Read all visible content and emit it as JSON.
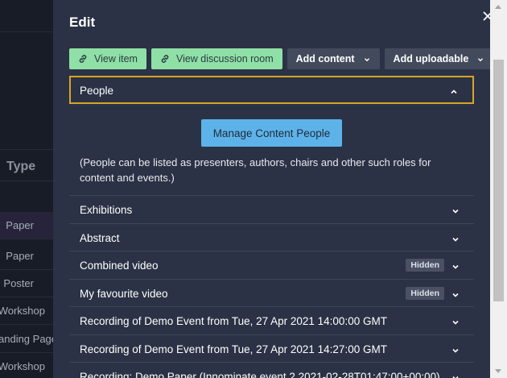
{
  "background": {
    "column_header": "Type",
    "rows": [
      "Paper",
      "Paper",
      "Poster",
      "Workshop",
      "anding Page",
      "Workshop"
    ]
  },
  "drawer": {
    "title": "Edit",
    "toolbar": {
      "view_item": "View item",
      "view_discussion_room": "View discussion room",
      "add_content": "Add content",
      "add_uploadable": "Add uploadable"
    },
    "people": {
      "label": "People",
      "manage_button": "Manage Content People",
      "note": "(People can be listed as presenters, authors, chairs and other such roles for content and events.)"
    },
    "items": [
      {
        "label": "Exhibitions",
        "badge": ""
      },
      {
        "label": "Abstract",
        "badge": ""
      },
      {
        "label": "Combined video",
        "badge": "Hidden"
      },
      {
        "label": "My favourite video",
        "badge": "Hidden"
      },
      {
        "label": "Recording of Demo Event from Tue, 27 Apr 2021 14:00:00 GMT",
        "badge": ""
      },
      {
        "label": "Recording of Demo Event from Tue, 27 Apr 2021 14:27:00 GMT",
        "badge": ""
      },
      {
        "label": "Recording: Demo Paper (Innominate event 2 2021-02-28T01:47:00+00:00)",
        "badge": ""
      }
    ]
  },
  "colors": {
    "drawer_bg": "#2b3245",
    "accent_green": "#8fe0a6",
    "accent_blue": "#5db3e9",
    "focus_border": "#d8a425"
  },
  "icons": {
    "close": "close-icon",
    "link": "link-icon",
    "chevron_down": "chevron-down-icon",
    "chevron_up": "chevron-up-icon"
  }
}
